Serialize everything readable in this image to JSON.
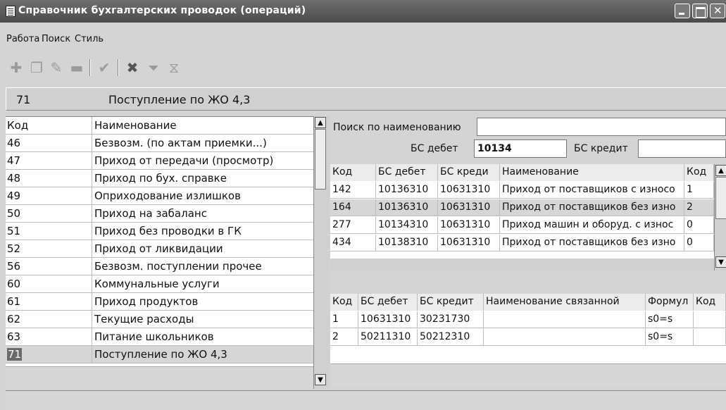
{
  "window": {
    "title": "Справочник бухгалтерских проводок (операций)"
  },
  "menu": [
    {
      "label": "Работа"
    },
    {
      "label": "Поиск"
    },
    {
      "label": "Стиль"
    }
  ],
  "toolbar": {
    "buttons": [
      {
        "name": "add-icon",
        "glyph": "✚"
      },
      {
        "name": "copy-icon",
        "glyph": "❐"
      },
      {
        "name": "edit-icon",
        "glyph": "✎"
      },
      {
        "name": "remove-icon",
        "glyph": "▬"
      },
      {
        "name": "checkmark-icon",
        "glyph": "✔"
      },
      {
        "name": "cancel-icon",
        "glyph": "✖"
      },
      {
        "name": "filter-icon",
        "glyph": "⏷"
      },
      {
        "name": "clear-filter-icon",
        "glyph": "⧖"
      }
    ]
  },
  "current": {
    "code": "71",
    "name": "Поступление по ЖО 4,3"
  },
  "left_grid": {
    "headers": [
      "Код",
      "Наименование"
    ],
    "rows": [
      [
        "46",
        "Безвозм. (по актам приемки...)"
      ],
      [
        "47",
        "Приход от передачи (просмотр)"
      ],
      [
        "48",
        "Приход по бух. справке"
      ],
      [
        "49",
        "Оприходование излишков"
      ],
      [
        "50",
        "Приход на забаланс"
      ],
      [
        "51",
        "Приход без проводки в ГК"
      ],
      [
        "52",
        "Приход от ликвидации"
      ],
      [
        "56",
        "Безвозм. поступлении прочее"
      ],
      [
        "60",
        "Коммунальные услуги"
      ],
      [
        "61",
        "Приход продуктов"
      ],
      [
        "62",
        "Текущие расходы"
      ],
      [
        "63",
        "Питание школьников"
      ],
      [
        "71",
        "Поступление по ЖО 4,3"
      ]
    ],
    "selected_index": 12
  },
  "search": {
    "label": "Поиск по наименованию",
    "value": "",
    "debit_label": "БС дебет",
    "debit_value": "10134",
    "credit_label": "БС кредит",
    "credit_value": ""
  },
  "ops_grid": {
    "headers": [
      "Код",
      "БС дебет",
      "БС креди",
      "Наименование",
      "Код"
    ],
    "rows": [
      [
        "142",
        "10136310",
        "10631310",
        "Приход от поставщиков с износо",
        "1"
      ],
      [
        "164",
        "10136310",
        "10631310",
        "Приход от поставщиков без изно",
        "2"
      ],
      [
        "277",
        "10134310",
        "10631310",
        "Приход машин и оборуд. с износ",
        "0"
      ],
      [
        "434",
        "10138310",
        "10631310",
        "Приход от поставщиков без изно",
        "0"
      ]
    ],
    "selected_index": 1
  },
  "links_grid": {
    "headers": [
      "Код",
      "БС дебет",
      "БС кредит",
      "Наименование связанной",
      "Формул",
      "Код"
    ],
    "rows": [
      [
        "1",
        "10631310",
        "30231730",
        "",
        "s0=s",
        ""
      ],
      [
        "2",
        "50211310",
        "50212310",
        "",
        "s0=s",
        ""
      ]
    ]
  }
}
